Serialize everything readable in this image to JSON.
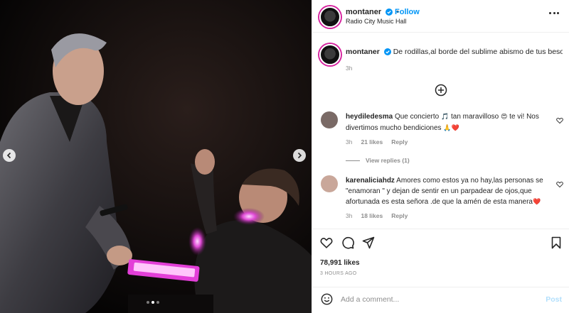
{
  "post": {
    "username": "montaner",
    "follow_label": "Follow",
    "location": "Radio City Music Hall",
    "caption_text": "De rodillas,al borde del sublime abismo de tus besos...",
    "caption_time": "3h",
    "likes": "78,991 likes",
    "posted_ago": "3 HOURS AGO"
  },
  "comments": [
    {
      "username": "heydiledesma",
      "text_a": "Que concierto ",
      "emoji_a": "🎵",
      "text_b": " tan maravilloso ",
      "emoji_b": "😍",
      "text_c": " te vi! Nos divertimos mucho bendiciones ",
      "emoji_c": "🙏❤️",
      "time": "3h",
      "likes": "21 likes",
      "reply_label": "Reply",
      "avatar_color": "#7a6a66"
    },
    {
      "username": "karenaliciahdz",
      "text_a": "Amores como estos ya no hay,las personas se \"enamoran \" y dejan de sentir en un parpadear de ojos,que afortunada es esta señora .de que la amén de esta manera",
      "emoji_a": "❤️",
      "time": "3h",
      "likes": "18 likes",
      "reply_label": "Reply",
      "avatar_color": "#c9a79a"
    }
  ],
  "view_replies": "View replies (1)",
  "composer": {
    "placeholder": "Add a comment...",
    "post_label": "Post"
  },
  "icons": {
    "verified": "verified-badge-icon",
    "more": "more-options-icon",
    "load_more": "plus-circle-icon",
    "like": "heart-icon",
    "comment": "comment-bubble-icon",
    "share": "paper-plane-icon",
    "save": "bookmark-icon",
    "emoji": "smiley-icon",
    "prev": "chevron-left-icon",
    "next": "chevron-right-icon"
  },
  "colors": {
    "link_blue": "#0095f6",
    "muted": "#8e8e8e",
    "post_disabled": "#b2dffc",
    "heart_red": "#e0245e"
  }
}
